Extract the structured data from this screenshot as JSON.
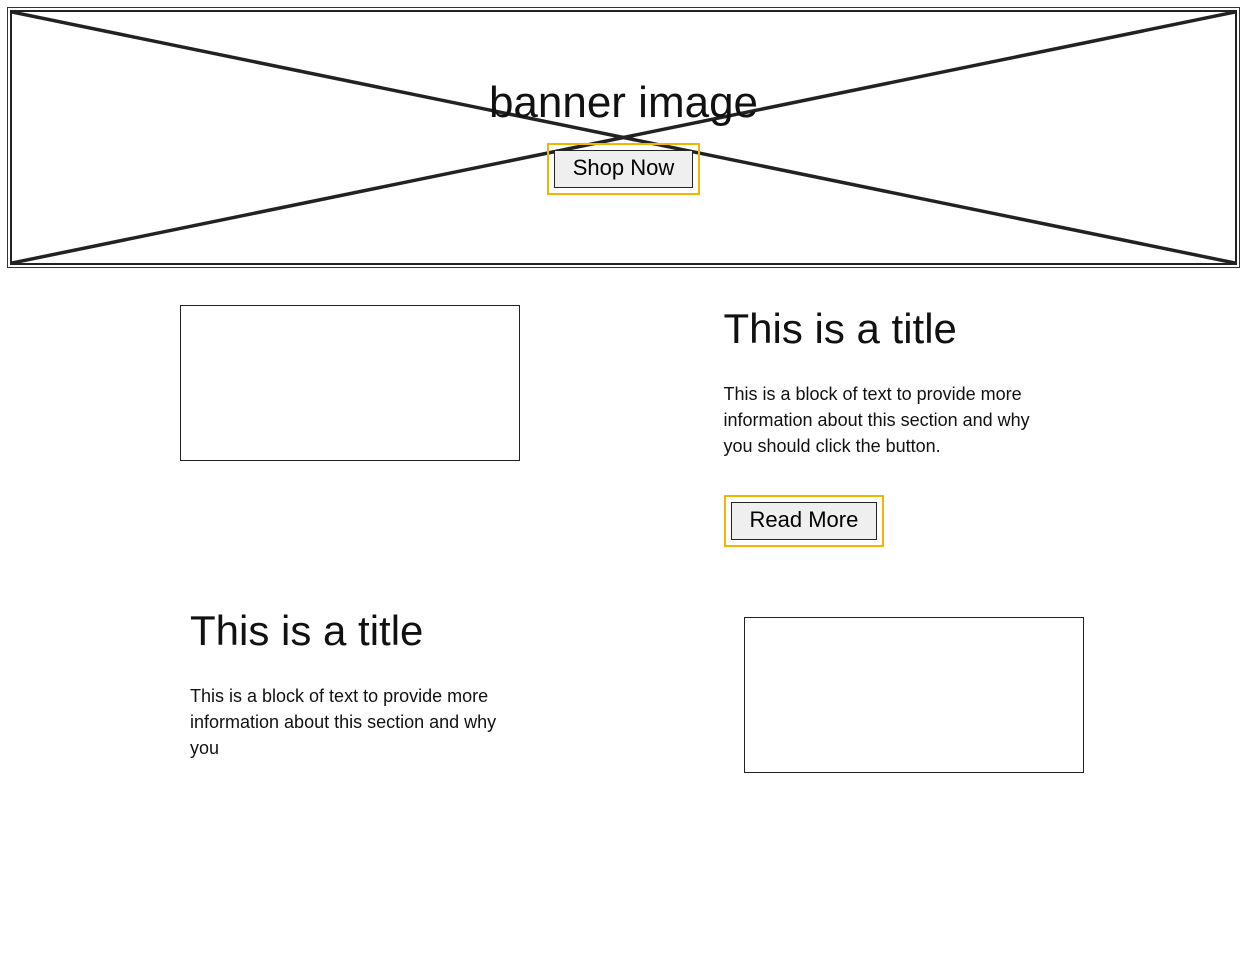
{
  "banner": {
    "placeholder_label": "banner image",
    "cta_label": "Shop Now"
  },
  "sections": [
    {
      "title": "This is a title",
      "body": "This is a block of text to provide more information about this section and why you should click the button.",
      "cta_label": "Read More"
    },
    {
      "title": "This is a title",
      "body": "This is a block of text to provide more information about this section and why you"
    }
  ],
  "colors": {
    "highlight": "#f2b600",
    "ink": "#222222"
  }
}
